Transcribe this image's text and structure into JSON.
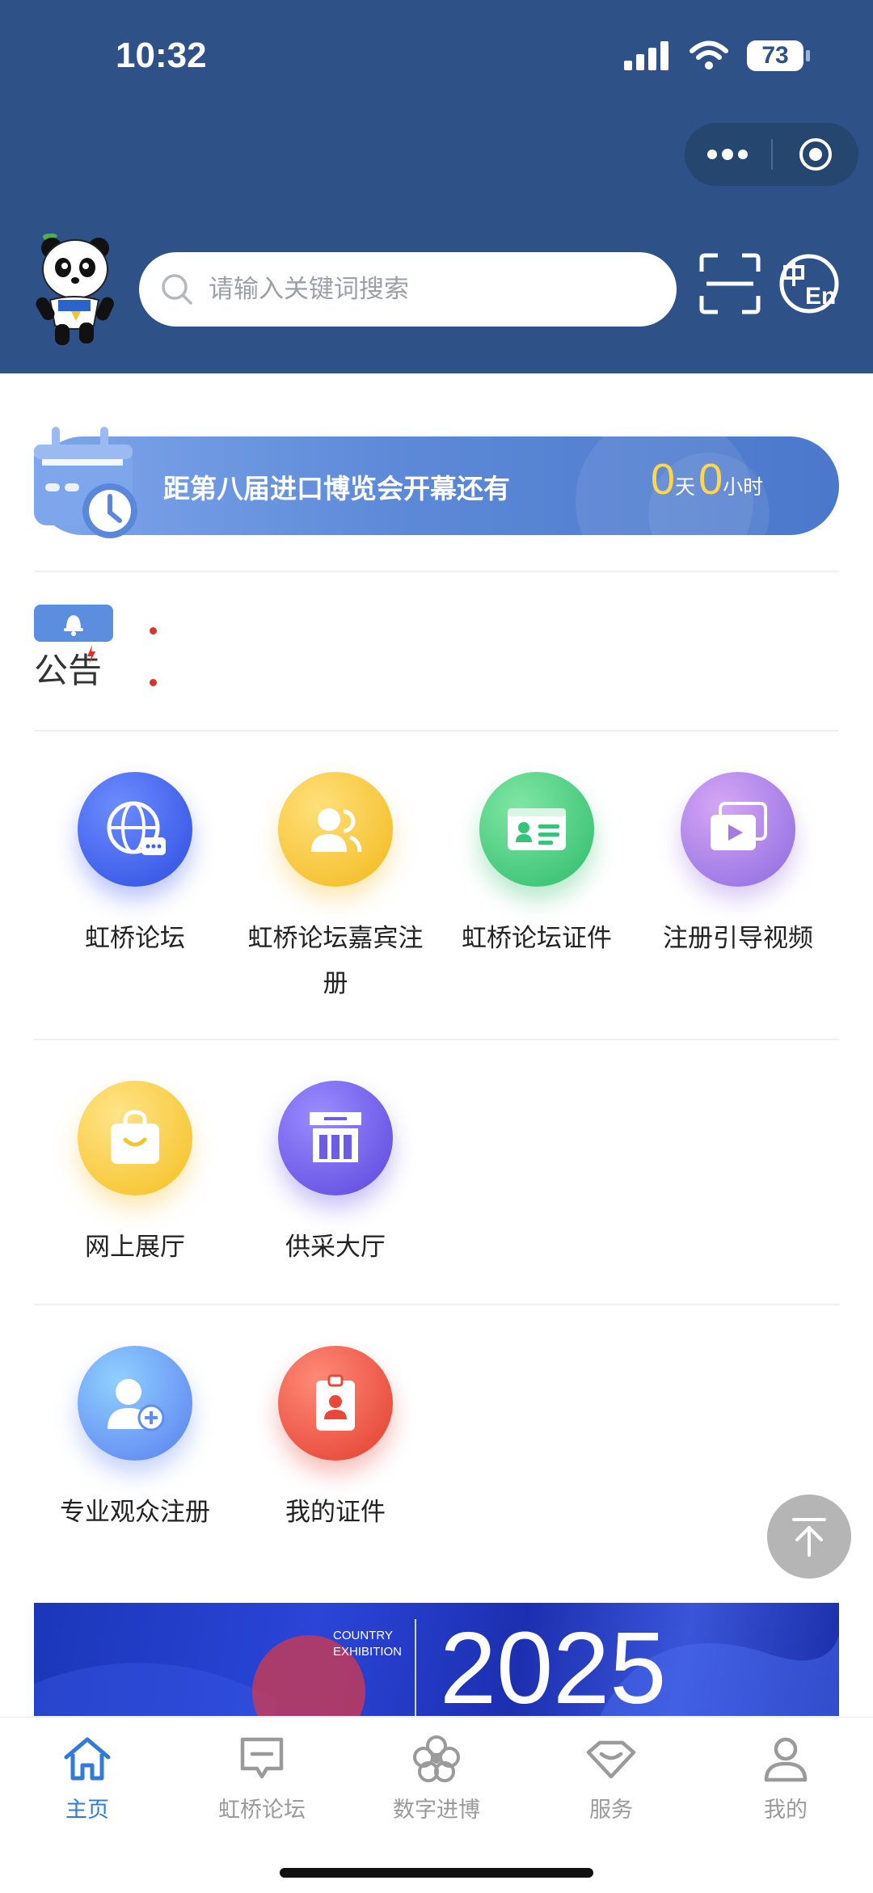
{
  "status_bar": {
    "time": "10:32",
    "battery": "73"
  },
  "header": {
    "search": {
      "placeholder": "请输入关键词搜索",
      "value": ""
    },
    "icons": [
      "mascot-panda",
      "scan-icon",
      "language-zh-en-icon",
      "more-dots-icon",
      "close-target-icon"
    ]
  },
  "countdown": {
    "text": "距第八届进口博览会开幕还有",
    "days": "0",
    "days_unit": "天",
    "hours": "0",
    "hours_unit": "小时"
  },
  "notice": {
    "label": "公告"
  },
  "grid": {
    "row1": [
      {
        "label": "虹桥论坛",
        "icon": "globe-chat-icon",
        "color": "#3c63ee"
      },
      {
        "label": "虹桥论坛嘉宾注册",
        "icon": "user-group-icon",
        "color": "#f5c428"
      },
      {
        "label": "虹桥论坛证件",
        "icon": "id-card-icon",
        "color": "#37c47a"
      },
      {
        "label": "注册引导视频",
        "icon": "video-icon",
        "color": "#a57be3"
      }
    ],
    "row2": [
      {
        "label": "网上展厅",
        "icon": "shopping-bag-icon",
        "color": "#f5c428"
      },
      {
        "label": "供采大厅",
        "icon": "hall-icon",
        "color": "#6d5ce4"
      }
    ],
    "row3": [
      {
        "label": "专业观众注册",
        "icon": "add-user-icon",
        "color": "#5b8ef0"
      },
      {
        "label": "我的证件",
        "icon": "badge-icon",
        "color": "#e8473a"
      }
    ]
  },
  "banner": {
    "year": "2025",
    "line1": "COUNTRY",
    "line2": "EXHIBITION"
  },
  "tabs": [
    {
      "label": "主页",
      "icon": "home-icon",
      "active": true
    },
    {
      "label": "虹桥论坛",
      "icon": "message-icon",
      "active": false
    },
    {
      "label": "数字进博",
      "icon": "flower-icon",
      "active": false
    },
    {
      "label": "服务",
      "icon": "service-icon",
      "active": false
    },
    {
      "label": "我的",
      "icon": "profile-icon",
      "active": false
    }
  ],
  "colors": {
    "header_bg": "#2e5287",
    "accent": "#2f7bd6",
    "countdown_number": "#ffd74a"
  }
}
